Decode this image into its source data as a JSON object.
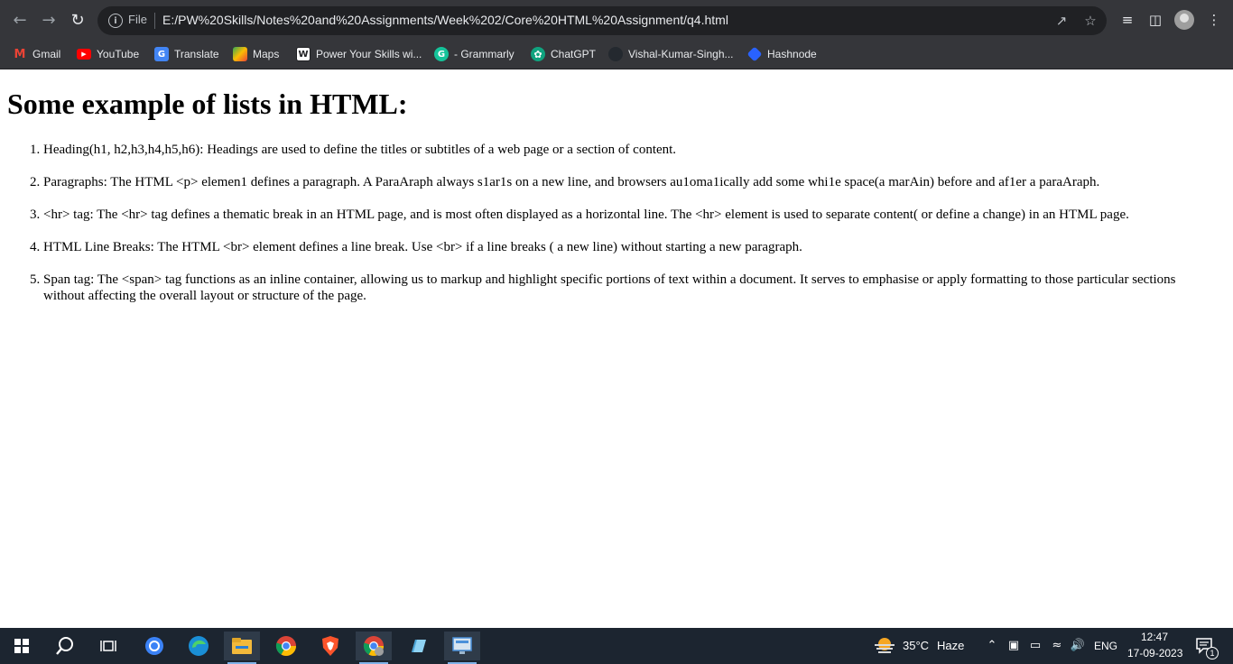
{
  "browser": {
    "nav": {
      "back_icon": "arrow-left-icon",
      "forward_icon": "arrow-right-icon",
      "reload_icon": "reload-icon"
    },
    "omnibox": {
      "info_label": "File",
      "url": "E:/PW%20Skills/Notes%20and%20Assignments/Week%202/Core%20HTML%20Assignment/q4.html"
    },
    "bookmarks": [
      {
        "label": "Gmail",
        "icon": "gmail-icon",
        "color": "#ea4335"
      },
      {
        "label": "YouTube",
        "icon": "youtube-icon",
        "color": "#ff0000"
      },
      {
        "label": "Translate",
        "icon": "translate-icon",
        "color": "#4285f4"
      },
      {
        "label": "Maps",
        "icon": "maps-icon",
        "color": "#34a853"
      },
      {
        "label": "Power Your Skills wi...",
        "icon": "pwskills-icon",
        "color": "#ffffff"
      },
      {
        "label": "- Grammarly",
        "icon": "grammarly-icon",
        "color": "#15c39a"
      },
      {
        "label": "ChatGPT",
        "icon": "chatgpt-icon",
        "color": "#10a37f"
      },
      {
        "label": "Vishal-Kumar-Singh...",
        "icon": "github-icon",
        "color": "#24292f"
      },
      {
        "label": "Hashnode",
        "icon": "hashnode-icon",
        "color": "#2962ff"
      }
    ]
  },
  "page": {
    "heading": "Some example of lists in HTML:",
    "items": [
      "Heading(h1, h2,h3,h4,h5,h6): Headings are used to define the titles or subtitles of a web page or a section of content.",
      "Paragraphs: The HTML <p> elemen1 defines a paragraph. A ParaAraph always s1ar1s on a new line, and browsers au1oma1ically add some whi1e space(a marAin) before and af1er a paraAraph.",
      "<hr> tag: The <hr> tag defines a thematic break in an HTML page, and is most often displayed as a horizontal line. The <hr> element is used to separate content( or define a change) in an HTML page.",
      "HTML Line Breaks: The HTML <br> element defines a line break. Use <br> if a line breaks ( a new line) without starting a new paragraph.",
      "Span tag: The <span> tag functions as an inline container, allowing us to markup and highlight specific portions of text within a document. It serves to emphasise or apply formatting to those particular sections without affecting the overall layout or structure of the page."
    ]
  },
  "taskbar": {
    "weather": {
      "temp": "35°C",
      "condition": "Haze"
    },
    "language": "ENG",
    "time": "12:47",
    "date": "17-09-2023",
    "notification_count": "1"
  }
}
